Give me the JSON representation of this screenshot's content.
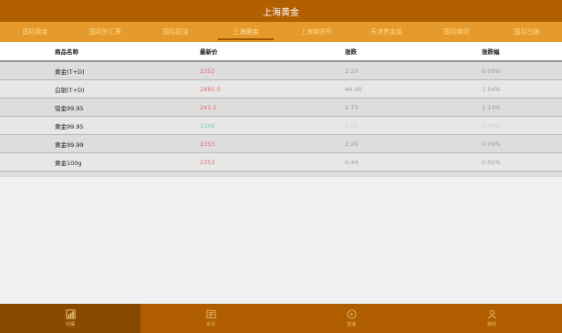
{
  "header": {
    "title": "上海黄金"
  },
  "tabs": [
    {
      "label": "国际黄金"
    },
    {
      "label": "国际外汇率"
    },
    {
      "label": "国际原油"
    },
    {
      "label": "上海黄金"
    },
    {
      "label": "上海期货所"
    },
    {
      "label": "天津贵金属"
    },
    {
      "label": "国际期货"
    },
    {
      "label": "国际白银"
    }
  ],
  "active_tab_index": 3,
  "table": {
    "columns": [
      "商品名称",
      "最新价",
      "涨跌",
      "涨跌幅"
    ],
    "rows": [
      {
        "name": "黄金(T+D)",
        "price": "2352",
        "change": "2.20",
        "pct": "0.09%"
      },
      {
        "name": "白银(T+D)",
        "price": "2885.0",
        "change": "44.00",
        "pct": "1.54%"
      },
      {
        "name": "铂金99.95",
        "price": "241.5",
        "change": "2.73",
        "pct": "1.14%"
      },
      {
        "name": "黄金99.95",
        "price": "2346",
        "change": "0.00",
        "pct": "0.00%"
      },
      {
        "name": "黄金99.99",
        "price": "2353",
        "change": "2.20",
        "pct": "0.09%"
      },
      {
        "name": "黄金100g",
        "price": "2353",
        "change": "0.44",
        "pct": "0.02%"
      }
    ]
  },
  "bottom_nav": [
    {
      "label": "行情",
      "icon": "chart-icon"
    },
    {
      "label": "资讯",
      "icon": "news-icon"
    },
    {
      "label": "直播",
      "icon": "live-icon"
    },
    {
      "label": "我的",
      "icon": "user-icon"
    }
  ],
  "active_bottom_index": 0,
  "colors": {
    "title_bar": "#b25f00",
    "tab_bar": "#e59a2b",
    "bottom_bar": "#b05d00",
    "up": "#e36b6b",
    "flat": "#79c9c9"
  }
}
